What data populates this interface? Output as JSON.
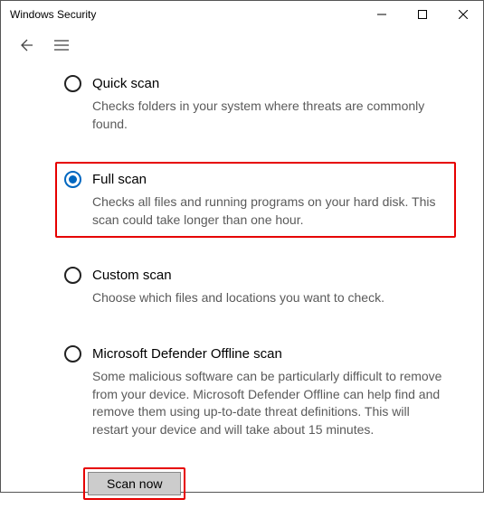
{
  "window": {
    "title": "Windows Security"
  },
  "options": [
    {
      "label": "Quick scan",
      "desc": "Checks folders in your system where threats are commonly found."
    },
    {
      "label": "Full scan",
      "desc": "Checks all files and running programs on your hard disk. This scan could take longer than one hour."
    },
    {
      "label": "Custom scan",
      "desc": "Choose which files and locations you want to check."
    },
    {
      "label": "Microsoft Defender Offline scan",
      "desc": "Some malicious software can be particularly difficult to remove from your device. Microsoft Defender Offline can help find and remove them using up-to-date threat definitions. This will restart your device and will take about 15 minutes."
    }
  ],
  "selected": 1,
  "action": {
    "scan_now": "Scan now"
  }
}
